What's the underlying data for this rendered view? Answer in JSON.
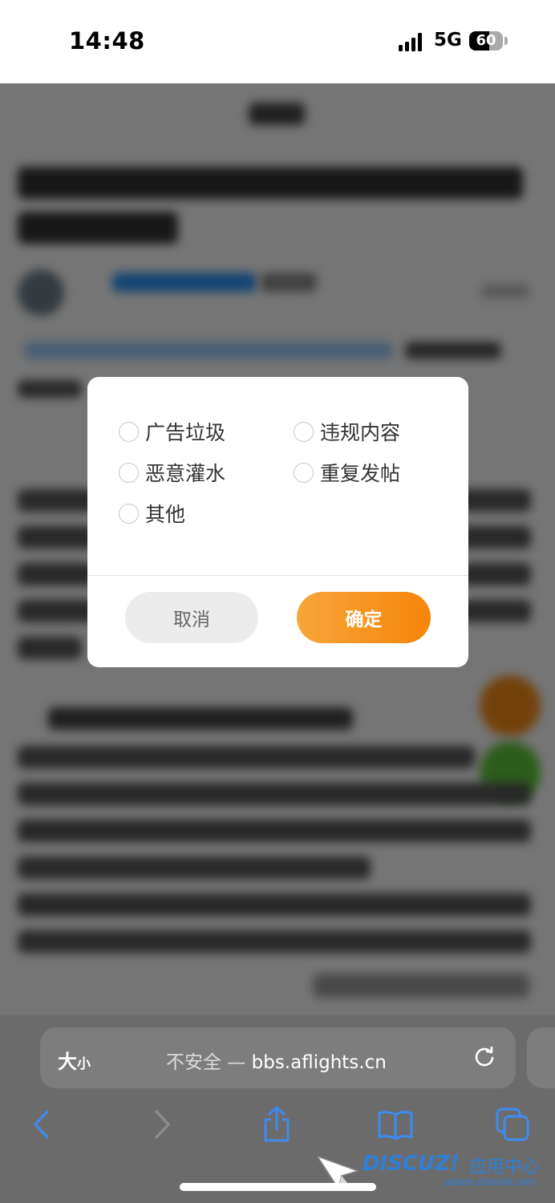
{
  "status_bar": {
    "time": "14:48",
    "network": "5G",
    "battery": "60",
    "battery_level": 0.6
  },
  "dialog": {
    "options": [
      "广告垃圾",
      "违规内容",
      "恶意灌水",
      "重复发帖",
      "其他"
    ],
    "cancel_label": "取消",
    "confirm_label": "确定"
  },
  "browser": {
    "text_size_big": "大",
    "text_size_small": "小",
    "url_prefix": "不安全 — ",
    "url_host": "bbs.aflights.cn"
  },
  "watermark": {
    "brand": "DISCUZ!",
    "title": "应用中心",
    "sub": "addon.dismall.com"
  },
  "colors": {
    "accent": "#f6850a",
    "safari_blue": "#3b8bf0",
    "overlay": "rgba(0,0,0,0.52)"
  },
  "icons": [
    "back-icon",
    "forward-icon",
    "share-icon",
    "bookmarks-icon",
    "tabs-icon",
    "reload-icon"
  ]
}
